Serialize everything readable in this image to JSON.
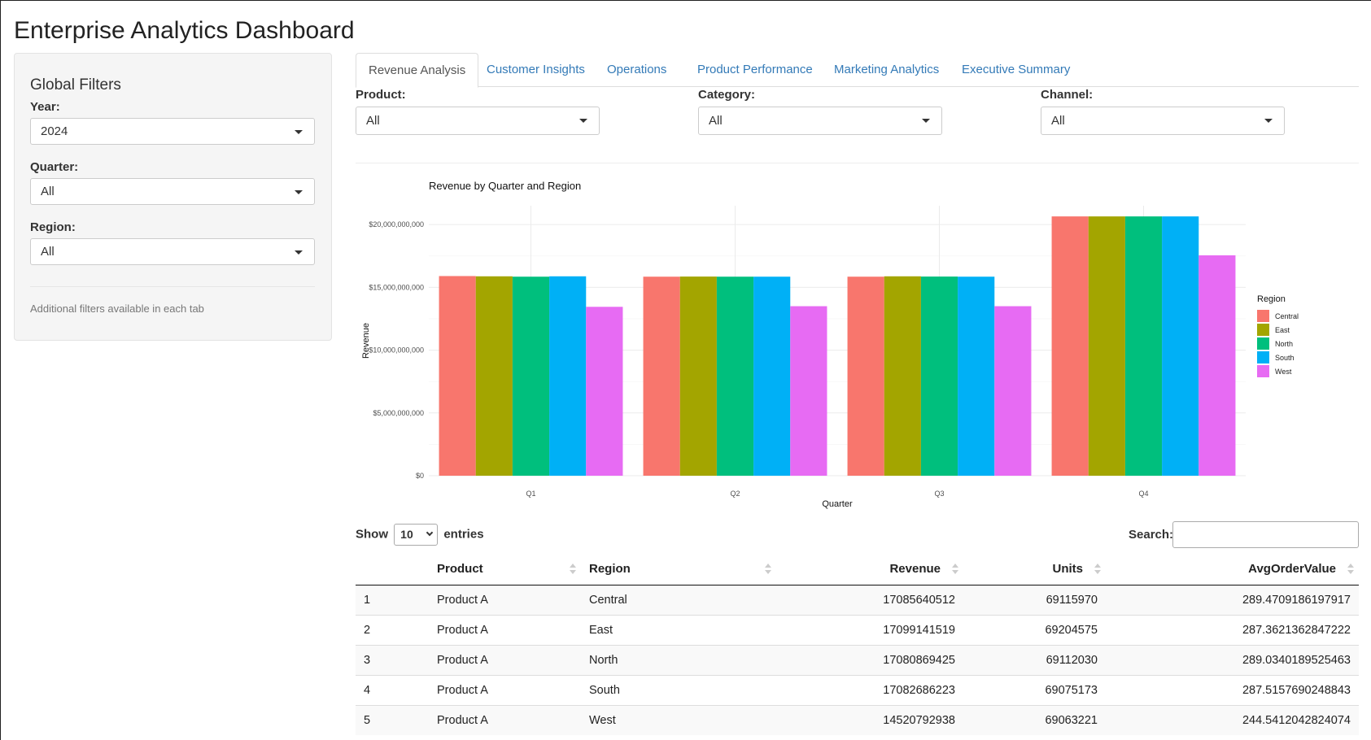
{
  "app": {
    "title": "Enterprise Analytics Dashboard"
  },
  "sidebar": {
    "title": "Global Filters",
    "filters": [
      {
        "label": "Year:",
        "value": "2024"
      },
      {
        "label": "Quarter:",
        "value": "All"
      },
      {
        "label": "Region:",
        "value": "All"
      }
    ],
    "note": "Additional filters available in each tab"
  },
  "tabs": [
    {
      "label": "Revenue Analysis",
      "active": true
    },
    {
      "label": "Customer Insights",
      "active": false
    },
    {
      "label": "Operations",
      "active": false
    },
    {
      "label": "Product Performance",
      "active": false
    },
    {
      "label": "Marketing Analytics",
      "active": false
    },
    {
      "label": "Executive Summary",
      "active": false
    }
  ],
  "tab_filters": [
    {
      "label": "Product:",
      "value": "All"
    },
    {
      "label": "Category:",
      "value": "All"
    },
    {
      "label": "Channel:",
      "value": "All"
    }
  ],
  "chart_data": {
    "type": "bar",
    "title": "Revenue by Quarter and Region",
    "xlabel": "Quarter",
    "ylabel": "Revenue",
    "categories": [
      "Q1",
      "Q2",
      "Q3",
      "Q4"
    ],
    "ylim": [
      0,
      21500000000
    ],
    "yticks": [
      0,
      5000000000,
      10000000000,
      15000000000,
      20000000000
    ],
    "ytick_labels": [
      "$0",
      "$5,000,000,000",
      "$10,000,000,000",
      "$15,000,000,000",
      "$20,000,000,000"
    ],
    "legend_title": "Region",
    "legend_position": "right",
    "grid": true,
    "series": [
      {
        "name": "Central",
        "color": "#F8766D",
        "values": [
          15900000000,
          15850000000,
          15850000000,
          20650000000
        ]
      },
      {
        "name": "East",
        "color": "#A3A500",
        "values": [
          15880000000,
          15860000000,
          15880000000,
          20650000000
        ]
      },
      {
        "name": "North",
        "color": "#00BF7D",
        "values": [
          15850000000,
          15850000000,
          15860000000,
          20650000000
        ]
      },
      {
        "name": "South",
        "color": "#00B0F6",
        "values": [
          15880000000,
          15850000000,
          15850000000,
          20650000000
        ]
      },
      {
        "name": "West",
        "color": "#E76BF3",
        "values": [
          13450000000,
          13500000000,
          13500000000,
          17550000000
        ]
      }
    ]
  },
  "table": {
    "length_prefix": "Show",
    "length_value": "10",
    "length_suffix": "entries",
    "search_label": "Search:",
    "search_value": "",
    "columns": [
      "",
      "Product",
      "Region",
      "Revenue",
      "Units",
      "AvgOrderValue"
    ],
    "rows": [
      [
        "1",
        "Product A",
        "Central",
        "17085640512",
        "69115970",
        "289.4709186197917"
      ],
      [
        "2",
        "Product A",
        "East",
        "17099141519",
        "69204575",
        "287.3621362847222"
      ],
      [
        "3",
        "Product A",
        "North",
        "17080869425",
        "69112030",
        "289.0340189525463"
      ],
      [
        "4",
        "Product A",
        "South",
        "17082686223",
        "69075173",
        "287.5157690248843"
      ],
      [
        "5",
        "Product A",
        "West",
        "14520792938",
        "69063221",
        "244.5412042824074"
      ]
    ]
  }
}
